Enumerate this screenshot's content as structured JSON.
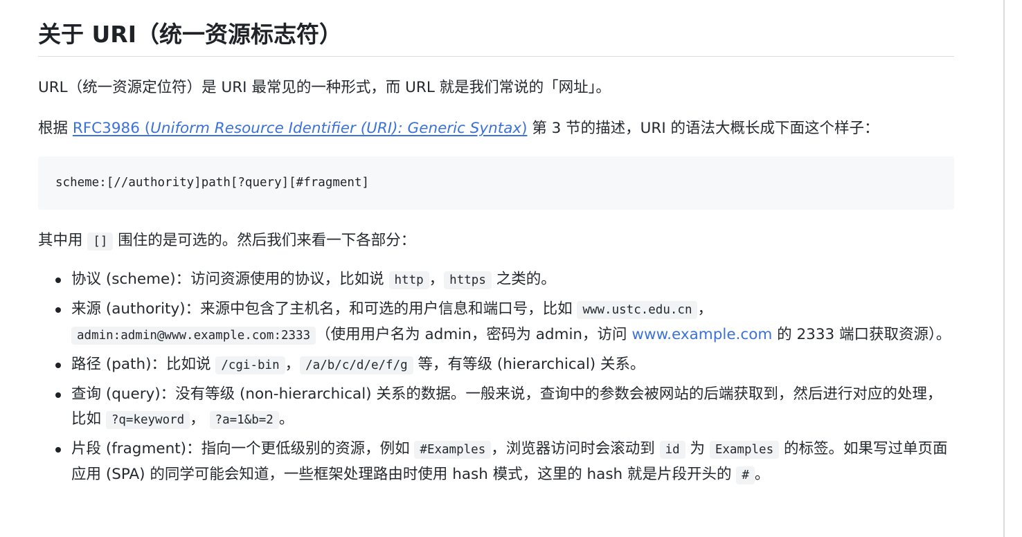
{
  "heading": "关于 URI（统一资源标志符）",
  "intro": {
    "text": "URL（统一资源定位符）是 URI 最常见的一种形式，而 URL 就是我们常说的「网址」。"
  },
  "rfc_paragraph": {
    "prefix": "根据 ",
    "link_plain": "RFC3986 (",
    "link_italic": "Uniform Resource Identifier (URI): Generic Syntax",
    "link_close": ")",
    "suffix": " 第 3 节的描述，URI 的语法大概长成下面这个样子："
  },
  "syntax_code": "scheme:[//authority]path[?query][#fragment]",
  "optional_paragraph": {
    "before": "其中用 ",
    "code": "[]",
    "after": " 围住的是可选的。然后我们来看一下各部分："
  },
  "items": [
    {
      "t1": "协议 (scheme)：访问资源使用的协议，比如说 ",
      "c1": "http",
      "t2": "，",
      "c2": "https",
      "t3": " 之类的。"
    },
    {
      "t1": "来源 (authority)：来源中包含了主机名，和可选的用户信息和端口号，比如 ",
      "c1": "www.ustc.edu.cn",
      "t2": "，",
      "c2": "admin:admin@www.example.com:2333",
      "t3": "（使用用户名为 admin，密码为 admin，访问 ",
      "link": "www.example.com",
      "t4": " 的 2333 端口获取资源）。"
    },
    {
      "t1": "路径 (path)：比如说 ",
      "c1": "/cgi-bin",
      "t2": "，",
      "c2": "/a/b/c/d/e/f/g",
      "t3": " 等，有等级 (hierarchical) 关系。"
    },
    {
      "t1": "查询 (query)：没有等级 (non-hierarchical) 关系的数据。一般来说，查询中的参数会被网站的后端获取到，然后进行对应的处理，比如 ",
      "c1": "?q=keyword",
      "t2": "， ",
      "c2": "?a=1&b=2",
      "t3": "。"
    },
    {
      "t1": "片段 (fragment)：指向一个更低级别的资源，例如 ",
      "c1": "#Examples",
      "t2": "，浏览器访问时会滚动到 ",
      "c2": "id",
      "t3": " 为 ",
      "c3": "Examples",
      "t4": " 的标签。如果写过单页面应用 (SPA) 的同学可能会知道，一些框架处理路由时使用 hash 模式，这里的 hash 就是片段开头的 ",
      "c4": "#",
      "t5": "。"
    }
  ]
}
